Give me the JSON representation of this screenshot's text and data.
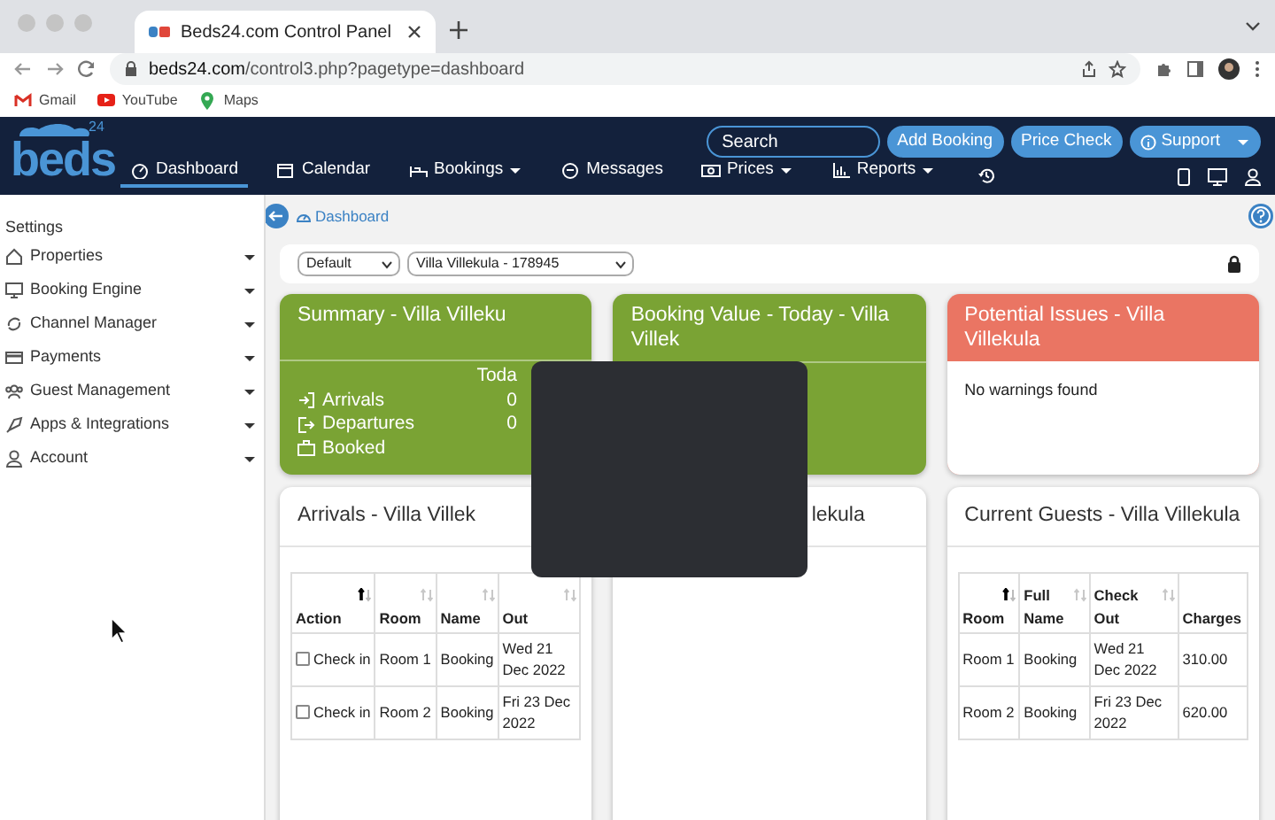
{
  "browser": {
    "tab_title": "Beds24.com Control Panel",
    "url_host": "beds24.com",
    "url_path": "/control3.php?pagetype=dashboard",
    "bookmarks": [
      "Gmail",
      "YouTube",
      "Maps"
    ]
  },
  "navbar": {
    "logo": {
      "name": "beds",
      "suffix": "24"
    },
    "search": {
      "placeholder": "Search"
    },
    "buttons": [
      "Add Booking",
      "Price Check",
      "Support"
    ],
    "menu": [
      {
        "label": "Dashboard",
        "selected": true,
        "dropdown": false
      },
      {
        "label": "Calendar",
        "selected": false,
        "dropdown": false
      },
      {
        "label": "Bookings",
        "selected": false,
        "dropdown": true
      },
      {
        "label": "Messages",
        "selected": false,
        "dropdown": false
      },
      {
        "label": "Prices",
        "selected": false,
        "dropdown": true
      },
      {
        "label": "Reports",
        "selected": false,
        "dropdown": true
      }
    ]
  },
  "sidebar": {
    "heading": "Settings",
    "items": [
      {
        "label": "Properties"
      },
      {
        "label": "Booking Engine"
      },
      {
        "label": "Channel Manager"
      },
      {
        "label": "Payments"
      },
      {
        "label": "Guest Management"
      },
      {
        "label": "Apps & Integrations"
      },
      {
        "label": "Account"
      }
    ]
  },
  "breadcrumb": "Dashboard",
  "filters": [
    "Default",
    "Villa Villekula - 178945"
  ],
  "top_cards": [
    {
      "kind": "summary",
      "title": "Summary - Villa Villeku",
      "color": "#7aa334",
      "column_header": "Toda",
      "rows": [
        {
          "label": "Arrivals",
          "value": "0"
        },
        {
          "label": "Departures",
          "value": "0"
        },
        {
          "label": "Booked"
        }
      ]
    },
    {
      "kind": "value",
      "title": "Booking Value - Today - Villa Villek",
      "color": "#7aa334"
    },
    {
      "kind": "issues",
      "title": "Potential Issues - Villa Villekula",
      "color": "#ea7563",
      "message": "No warnings found"
    }
  ],
  "bottom_cards": [
    {
      "kind": "table",
      "title": "Arrivals - Villa Villek",
      "columns": [
        {
          "label": "Action",
          "sorted": true
        },
        {
          "label": "Room",
          "sorted": false
        },
        {
          "label": "Name",
          "sorted": false
        },
        {
          "label": "Out",
          "sorted": false
        }
      ],
      "rows": [
        {
          "checked": false,
          "cells": [
            "Check in",
            "Room 1",
            "Booking",
            "Wed 21 Dec 2022"
          ]
        },
        {
          "checked": false,
          "cells": [
            "Check in",
            "Room 2",
            "Booking",
            "Fri 23 Dec 2022"
          ]
        }
      ]
    },
    {
      "kind": "empty",
      "title": "lekula"
    },
    {
      "kind": "table",
      "title": "Current Guests - Villa Villekula",
      "columns": [
        {
          "label": "Room",
          "sorted": true
        },
        {
          "label": "Full Name",
          "sorted": false
        },
        {
          "label": "Check Out",
          "sorted": false
        },
        {
          "label": "Charges"
        }
      ],
      "rows": [
        {
          "cells": [
            "Room 1",
            "Booking",
            "Wed 21 Dec 2022",
            "310.00"
          ]
        },
        {
          "cells": [
            "Room 2",
            "Booking",
            "Fri 23 Dec 2022",
            "620.00"
          ]
        }
      ]
    }
  ]
}
